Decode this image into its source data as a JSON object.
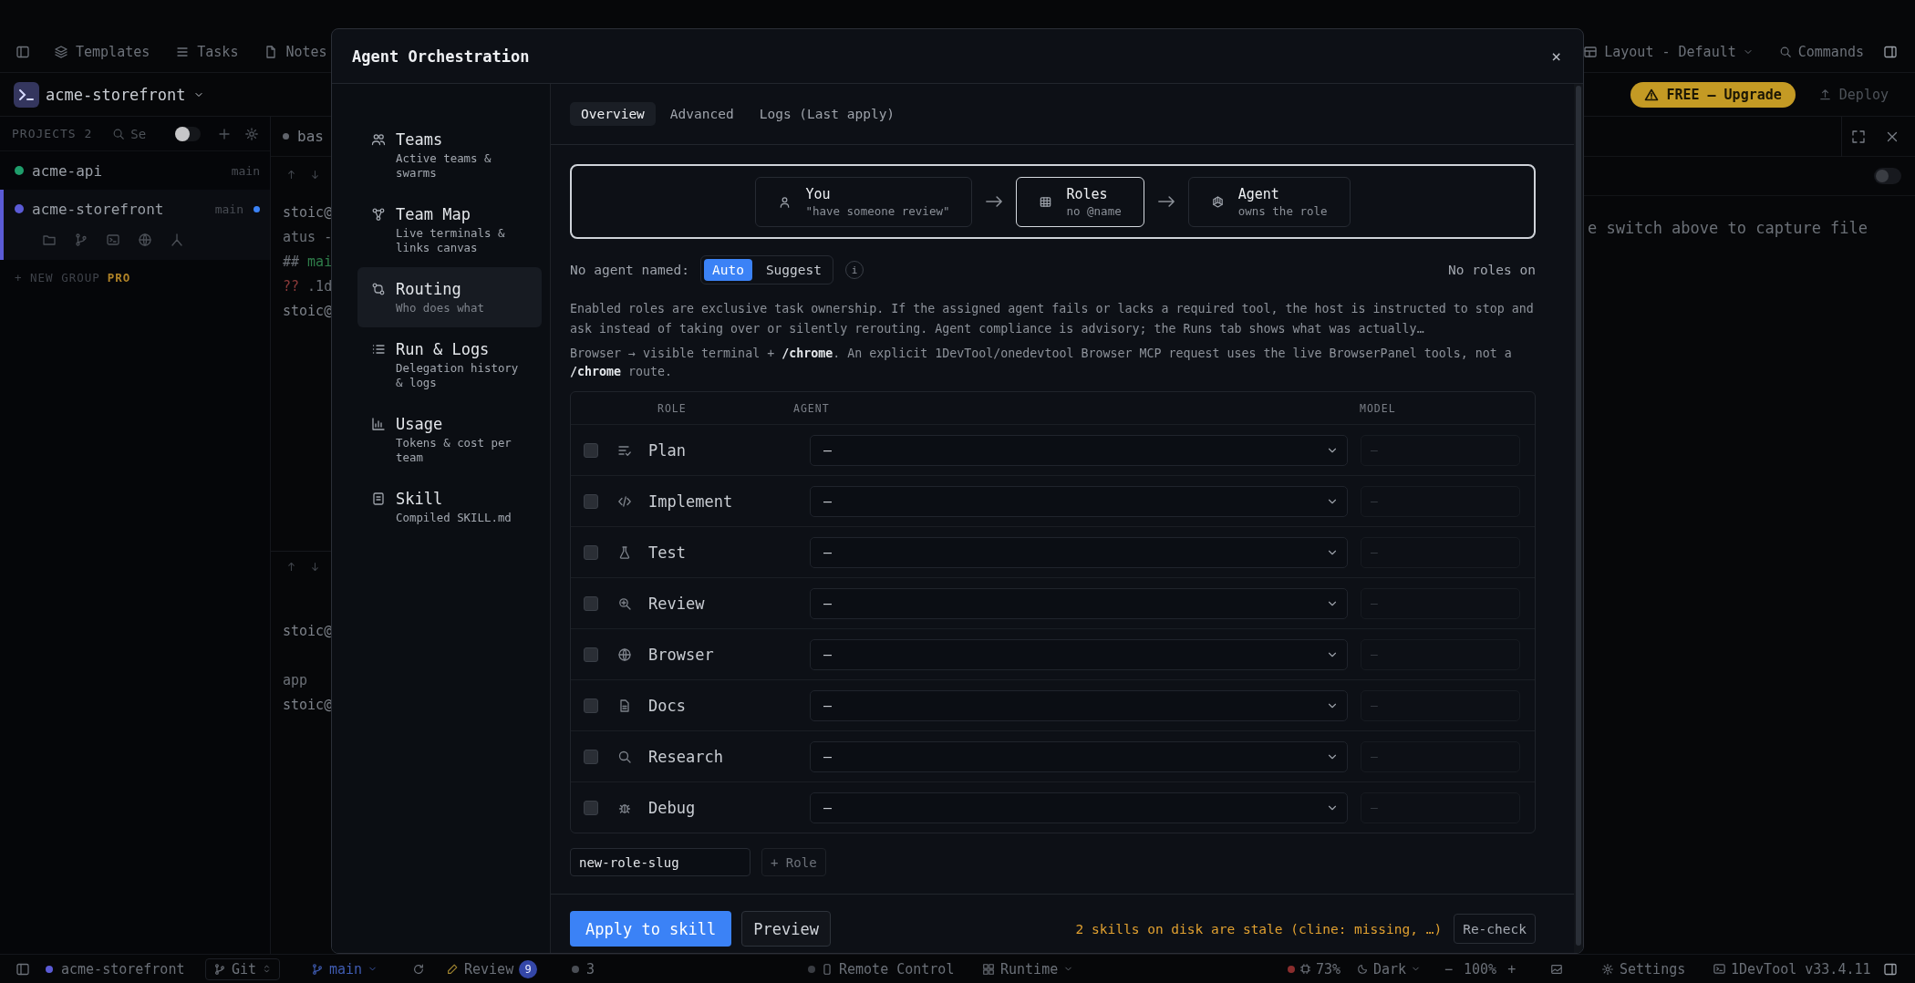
{
  "topbar": {
    "items": [
      {
        "label": "Templates"
      },
      {
        "label": "Tasks"
      },
      {
        "label": "Notes"
      }
    ],
    "layout": "Layout - Default",
    "commands": "Commands"
  },
  "project_bar": {
    "project": "acme-storefront",
    "upgrade": "FREE — Upgrade",
    "deploy": "Deploy"
  },
  "sidebar": {
    "title": "PROJECTS 2",
    "search_placeholder": "Se",
    "toggle_on": false,
    "projects": [
      {
        "name": "acme-api",
        "branch": "main",
        "color": "#1f9d6b",
        "unsaved": false,
        "selected": false
      },
      {
        "name": "acme-storefront",
        "branch": "main",
        "color": "#5b5bd6",
        "unsaved": true,
        "selected": true
      }
    ],
    "new_group": "+ NEW GROUP",
    "new_group_badge": "PRO"
  },
  "terminal": {
    "tab": "bas",
    "top_lines": [
      {
        "text": "stoic@",
        "kind": "prompt"
      },
      {
        "text": "atus -",
        "kind": "plain"
      },
      {
        "text": "## mai",
        "kind": "branch"
      },
      {
        "text": "?? .1d",
        "kind": "untracked"
      },
      {
        "text": "stoic@",
        "kind": "prompt"
      }
    ],
    "bottom_lines": [
      {
        "text": "stoic@",
        "kind": "prompt"
      },
      {
        "text": "app",
        "kind": "output"
      },
      {
        "text": "stoic@",
        "kind": "prompt"
      }
    ]
  },
  "right_panel": {
    "toggle_on": false,
    "hint": "e switch above to capture file"
  },
  "modal": {
    "title": "Agent Orchestration",
    "close": "×",
    "nav": [
      {
        "label": "Teams",
        "sub": "Active teams & swarms",
        "selected": false
      },
      {
        "label": "Team Map",
        "sub": "Live terminals & links canvas",
        "selected": false
      },
      {
        "label": "Routing",
        "sub": "Who does what",
        "selected": true
      },
      {
        "label": "Run & Logs",
        "sub": "Delegation history & logs",
        "selected": false
      },
      {
        "label": "Usage",
        "sub": "Tokens & cost per team",
        "selected": false
      },
      {
        "label": "Skill",
        "sub": "Compiled SKILL.md",
        "selected": false
      }
    ],
    "tabs": [
      {
        "label": "Overview",
        "selected": true
      },
      {
        "label": "Advanced",
        "selected": false
      },
      {
        "label": "Logs (Last apply)",
        "selected": false
      }
    ],
    "flow": [
      {
        "title": "You",
        "sub": "\"have someone review\"",
        "selected": false
      },
      {
        "title": "Roles",
        "sub": "no @name",
        "selected": true
      },
      {
        "title": "Agent",
        "sub": "owns the role",
        "selected": false
      }
    ],
    "mode": {
      "label": "No agent named:",
      "options": [
        {
          "label": "Auto",
          "selected": true
        },
        {
          "label": "Suggest",
          "selected": false
        }
      ],
      "info": "i"
    },
    "roles_status": "No roles on",
    "notes": [
      "Enabled roles are exclusive task ownership. If the assigned agent fails or lacks a required tool, the host is instructed to stop and ask instead of taking over or silently rerouting. Agent compliance is advisory; the Runs tab shows what was actually…",
      "Browser → visible terminal + **/chrome**. An explicit 1DevTool/onedevtool Browser MCP request uses the live BrowserPanel tools, not a **/chrome** route."
    ],
    "table": {
      "columns": [
        "ROLE",
        "AGENT",
        "MODEL"
      ],
      "rows": [
        {
          "role": "Plan",
          "checked": false,
          "agent": "—",
          "model": {
            "placeholder": "—"
          }
        },
        {
          "role": "Implement",
          "checked": false,
          "agent": "—",
          "model": {
            "placeholder": "—"
          }
        },
        {
          "role": "Test",
          "checked": false,
          "agent": "—",
          "model": {
            "placeholder": "—"
          }
        },
        {
          "role": "Review",
          "checked": false,
          "agent": "—",
          "model": {
            "placeholder": "—"
          }
        },
        {
          "role": "Browser",
          "checked": false,
          "agent": "—",
          "model": {
            "placeholder": "—"
          }
        },
        {
          "role": "Docs",
          "checked": false,
          "agent": "—",
          "model": {
            "placeholder": "—"
          }
        },
        {
          "role": "Research",
          "checked": false,
          "agent": "—",
          "model": {
            "placeholder": "—"
          }
        },
        {
          "role": "Debug",
          "checked": false,
          "agent": "—",
          "model": {
            "placeholder": "—"
          }
        }
      ]
    },
    "new_role": {
      "value": "new-role-slug",
      "add": "+ Role"
    },
    "footer": {
      "apply": "Apply to skill",
      "preview": "Preview",
      "warning": "2 skills on disk are stale (cline: missing, …)",
      "recheck": "Re-check"
    }
  },
  "status_bar": {
    "project": "acme-storefront",
    "git": "Git",
    "branch": "main",
    "review": "Review",
    "review_count": "9",
    "changes": "3",
    "remote": "Remote Control",
    "runtime": "Runtime",
    "cpu": "73%",
    "theme": "Dark",
    "zoom_out": "−",
    "zoom": "100%",
    "zoom_in": "+",
    "settings": "Settings",
    "version": "1DevTool v33.4.11"
  }
}
